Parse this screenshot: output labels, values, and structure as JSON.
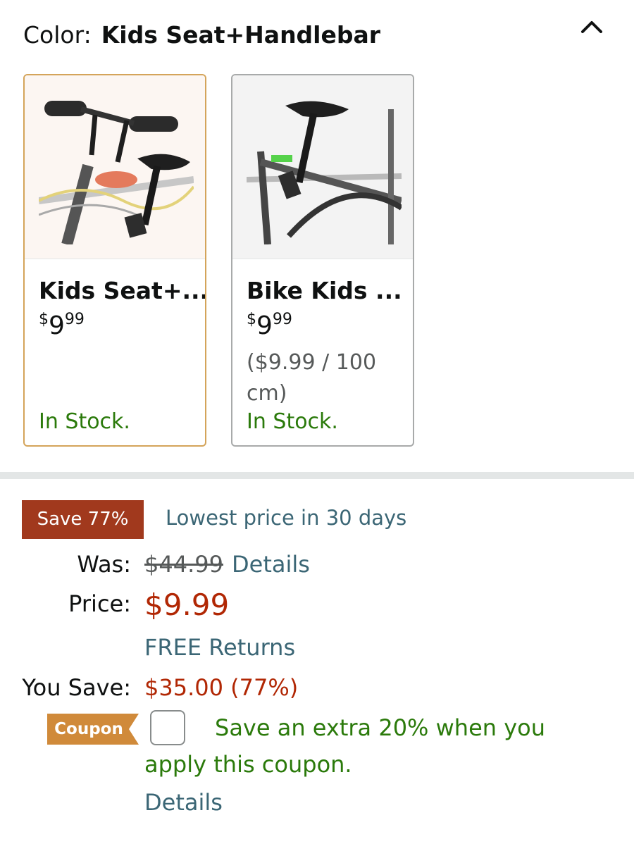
{
  "color": {
    "label": "Color:",
    "value": "Kids Seat+Handlebar"
  },
  "icons": {
    "collapse": "chevron-up-icon"
  },
  "swatches": [
    {
      "name": "Kids Seat+...",
      "price_symbol": "$",
      "price_whole": "9",
      "price_fraction": "99",
      "unit_price": "",
      "stock": "In Stock.",
      "selected": true
    },
    {
      "name": "Bike Kids ...",
      "price_symbol": "$",
      "price_whole": "9",
      "price_fraction": "99",
      "unit_price": "($9.99 / 100 cm)",
      "stock": "In Stock.",
      "selected": false
    }
  ],
  "deal": {
    "badge": "Save 77%",
    "note": "Lowest price in 30 days"
  },
  "pricing": {
    "was_label": "Was:",
    "was_value": "$44.99",
    "was_details": "Details",
    "price_label": "Price:",
    "price_value": "$9.99",
    "free_returns": "FREE Returns",
    "you_save_label": "You Save:",
    "you_save_value": "$35.00 (77%)"
  },
  "coupon": {
    "badge": "Coupon",
    "text_line1": "Save an extra 20% when you",
    "text_line2": "apply this coupon.",
    "details": "Details",
    "checked": false
  },
  "colors": {
    "deal_red": "#a1391d",
    "price_red": "#b12704",
    "link_teal": "#3b6675",
    "stock_green": "#2b7a0b",
    "coupon_orange": "#d08a3a",
    "selected_border": "#d4a45a"
  }
}
